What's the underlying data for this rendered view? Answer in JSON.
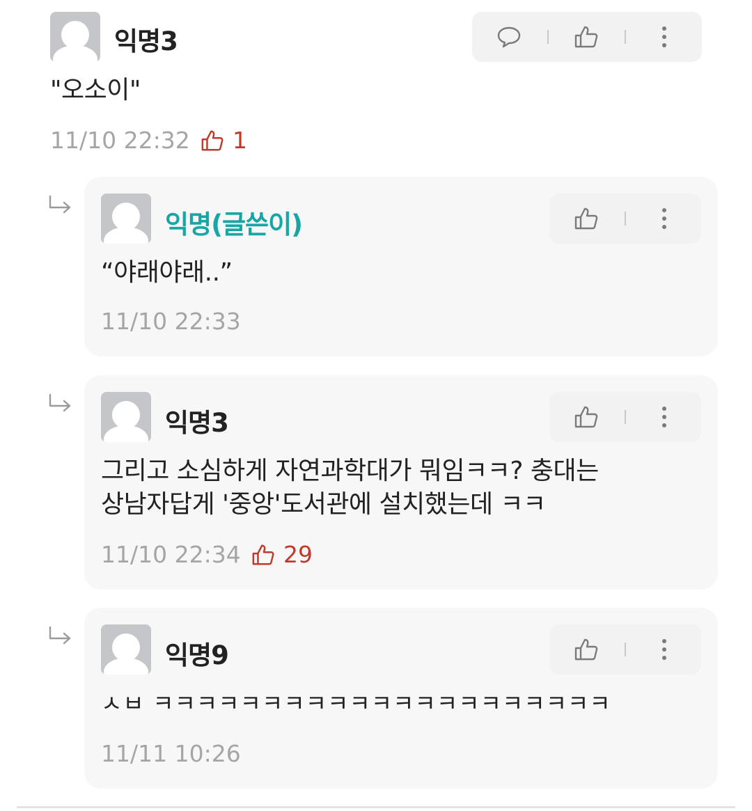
{
  "comments": [
    {
      "nickname": "익명3",
      "text": "\"오소이\"",
      "time": "11/10 22:32",
      "likes": "1"
    }
  ],
  "replies": [
    {
      "nickname": "익명(글쓴이)",
      "is_author": true,
      "text_lines": [
        "“야래야래..”"
      ],
      "time": "11/10 22:33",
      "likes": ""
    },
    {
      "nickname": "익명3",
      "is_author": false,
      "text_lines": [
        "그리고 소심하게 자연과학대가 뭐임ㅋㅋ? 충대는",
        "상남자답게 '중앙'도서관에 설치했는데 ㅋㅋ"
      ],
      "time": "11/10 22:34",
      "likes": "29"
    },
    {
      "nickname": "익명9",
      "is_author": false,
      "text_lines": [
        "ㅅㅂ ㅋㅋㅋㅋㅋㅋㅋㅋㅋㅋㅋㅋㅋㅋㅋㅋㅋㅋㅋㅋㅋ"
      ],
      "time": "11/11 10:26",
      "likes": ""
    }
  ],
  "icons": {
    "reply": "speech-bubble-icon",
    "like": "thumbs-up-icon",
    "more": "vertical-ellipsis-icon",
    "reply_indicator": "reply-arrow-icon"
  },
  "colors": {
    "author_nickname": "#17a6a6",
    "like_count": "#c0392b",
    "timestamp": "#a5a5a5",
    "reply_card_bg": "#f7f7f7"
  }
}
